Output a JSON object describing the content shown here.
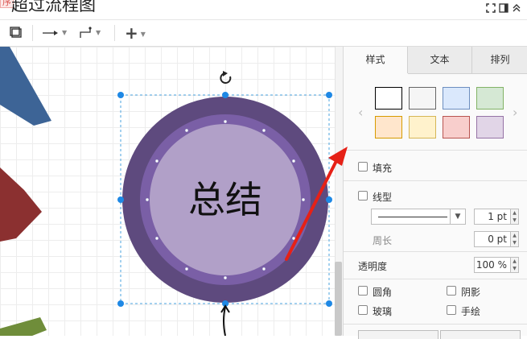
{
  "window": {
    "badge": "序",
    "title": "超过流程图",
    "icons": [
      "fit-page-icon",
      "format-panel-icon",
      "collapse-icon"
    ]
  },
  "toolbar": {
    "items": [
      "page-view-icon",
      "connector-arrow-icon",
      "waypoint-icon",
      "insert-plus-icon"
    ]
  },
  "shape": {
    "label": "总结",
    "outer_color": "#5e4a7e",
    "middle_color": "#7a5fa6",
    "inner_color": "#b1a0c8"
  },
  "panel": {
    "tabs": [
      "样式",
      "文本",
      "排列"
    ],
    "active_tab": "样式",
    "swatches": [
      {
        "fill": "#ffffff",
        "stroke": "#000000"
      },
      {
        "fill": "#f5f5f5",
        "stroke": "#666666"
      },
      {
        "fill": "#dae8fc",
        "stroke": "#6c8ebf"
      },
      {
        "fill": "#d5e8d4",
        "stroke": "#82b366"
      },
      {
        "fill": "#ffe6cc",
        "stroke": "#d79b00"
      },
      {
        "fill": "#fff2cc",
        "stroke": "#d6b656"
      },
      {
        "fill": "#f8cecc",
        "stroke": "#b85450"
      },
      {
        "fill": "#e1d5e7",
        "stroke": "#9673a6"
      }
    ],
    "fill_label": "填充",
    "line_label": "线型",
    "line_width": "1 pt",
    "perimeter_label": "周长",
    "perimeter_value": "0 pt",
    "opacity_label": "透明度",
    "opacity_value": "100 %",
    "rounded_label": "圆角",
    "shadow_label": "阴影",
    "glass_label": "玻璃",
    "sketch_label": "手绘"
  }
}
